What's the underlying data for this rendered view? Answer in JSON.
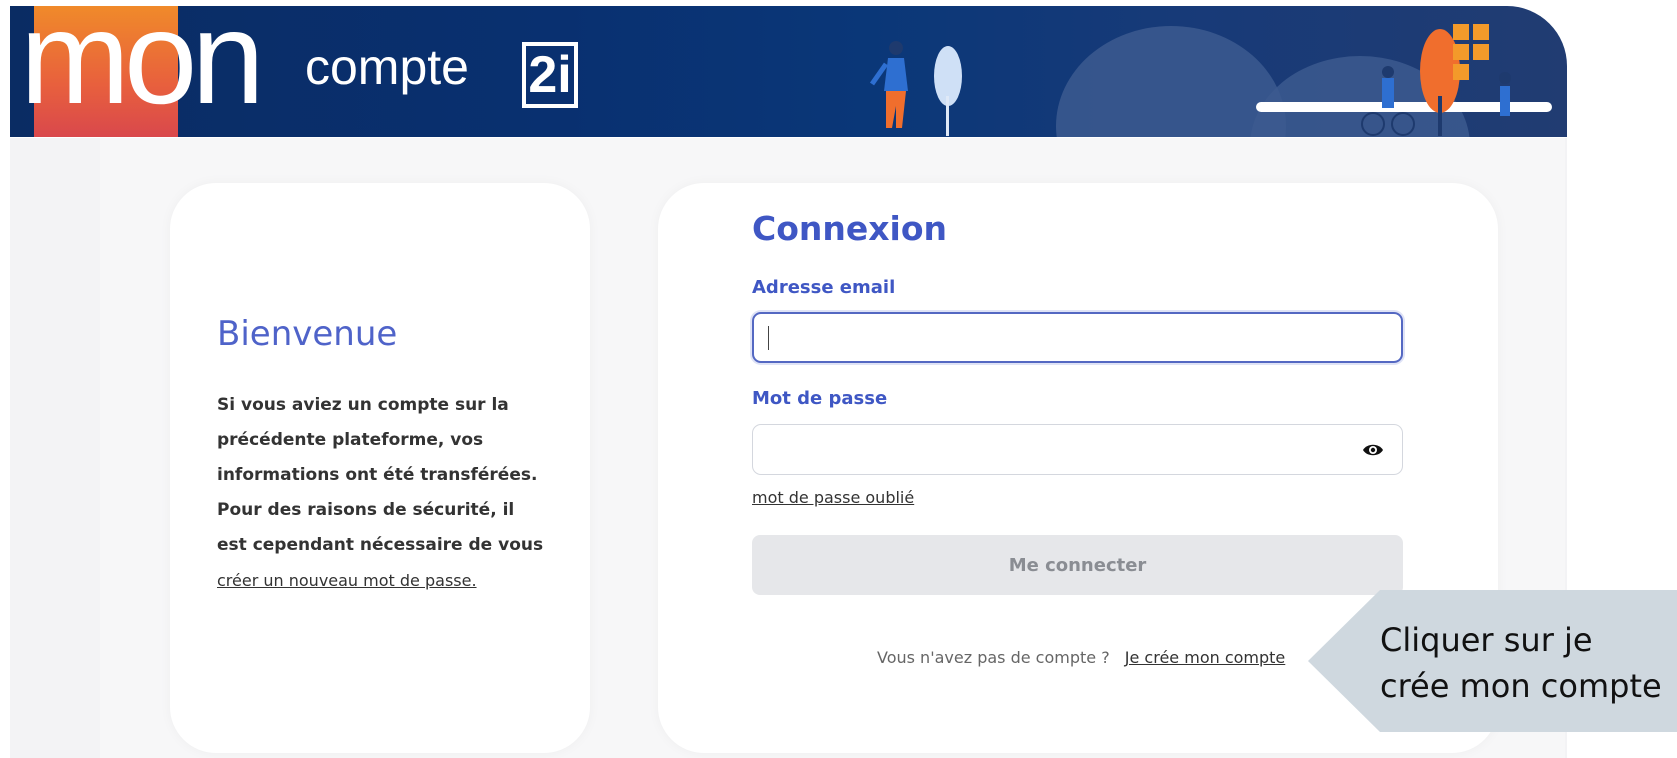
{
  "header": {
    "logo_text": "mon",
    "brand_word": "compte",
    "brand_badge": "2i"
  },
  "welcome": {
    "title": "Bienvenue",
    "text": "Si vous aviez un compte sur la précédente plateforme, vos informations ont été transférées. Pour des raisons de sécurité, il est cependant nécessaire de vous",
    "link": "créer un nouveau mot de passe."
  },
  "login": {
    "title": "Connexion",
    "email_label": "Adresse email",
    "email_value": "",
    "password_label": "Mot de passe",
    "password_value": "",
    "forgot_link": "mot de passe oublié",
    "submit_label": "Me connecter",
    "signup_prompt": "Vous n'avez pas de compte ?",
    "signup_link": "Je crée mon compte"
  },
  "callout": {
    "text": "Cliquer sur je crée mon compte"
  },
  "colors": {
    "accent": "#3f57c4",
    "header_dark": "#0a2c63",
    "logo_orange": "#f08a2a",
    "button_disabled": "#e6e7ea",
    "callout_bg": "#cfd8df"
  }
}
